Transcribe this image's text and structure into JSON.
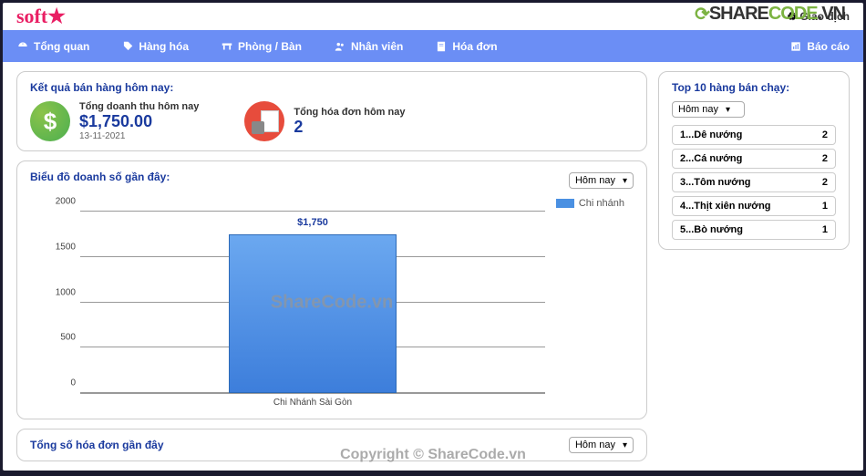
{
  "header": {
    "logo": "soft",
    "links": {
      "giaodich": "Giao dịch"
    }
  },
  "nav": {
    "tongquan": "Tổng quan",
    "hanghoa": "Hàng hóa",
    "phongban": "Phòng / Bàn",
    "nhanvien": "Nhân viên",
    "hoadon": "Hóa đơn",
    "baocao": "Báo cáo"
  },
  "kpi": {
    "title": "Kết quả bán hàng hôm nay:",
    "revenue": {
      "label": "Tổng doanh thu hôm nay",
      "value": "$1,750.00",
      "date": "13-11-2021"
    },
    "invoices": {
      "label": "Tổng hóa đơn hôm nay",
      "value": "2"
    }
  },
  "chart": {
    "title": "Biểu đồ doanh số gần đây:",
    "range_label": "Hôm nay",
    "legend": "Chi nhánh",
    "bar_label": "$1,750",
    "xaxis": "Chi Nhánh Sài Gòn",
    "ticks": {
      "t0": "0",
      "t500": "500",
      "t1000": "1000",
      "t1500": "1500",
      "t2000": "2000"
    }
  },
  "top10": {
    "title": "Top 10 hàng bán chạy:",
    "range_label": "Hôm nay",
    "items": [
      {
        "name": "1...Dê nướng",
        "qty": "2"
      },
      {
        "name": "2...Cá nướng",
        "qty": "2"
      },
      {
        "name": "3...Tôm nướng",
        "qty": "2"
      },
      {
        "name": "4...Thịt xiên nướng",
        "qty": "1"
      },
      {
        "name": "5...Bò nướng",
        "qty": "1"
      }
    ]
  },
  "invoice_chart": {
    "title": "Tổng số hóa đơn gần đây",
    "range_label": "Hôm nay"
  },
  "watermarks": {
    "brand": "SHARECODE.VN",
    "center": "ShareCode.vn",
    "copy": "Copyright © ShareCode.vn"
  },
  "chart_data": {
    "type": "bar",
    "categories": [
      "Chi Nhánh Sài Gòn"
    ],
    "values": [
      1750
    ],
    "title": "Biểu đồ doanh số gần đây",
    "xlabel": "",
    "ylabel": "",
    "ylim": [
      0,
      2000
    ],
    "legend": [
      "Chi nhánh"
    ]
  }
}
